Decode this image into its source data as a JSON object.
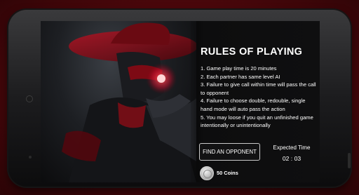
{
  "screen": {
    "title": "RULES OF PLAYING",
    "rules": [
      "1. Game play time is 20 minutes",
      "2. Each partner has same level AI",
      "3. Failure to give call within time will pass the call to opponent",
      "4. Failure to choose double, redouble, single hand mode will auto pass the action",
      "5. You may loose if you quit an unfinished game intentionally or unintentionally"
    ],
    "find_button": "FIND AN OPPONENT",
    "expected_time_label": "Expected Time",
    "expected_time_value": "02 : 03",
    "coins": "50 Coins"
  },
  "icons": {
    "coin": "coin-icon"
  },
  "colors": {
    "background": "#4a070b",
    "accent": "#c8102e",
    "text": "#ffffff"
  }
}
